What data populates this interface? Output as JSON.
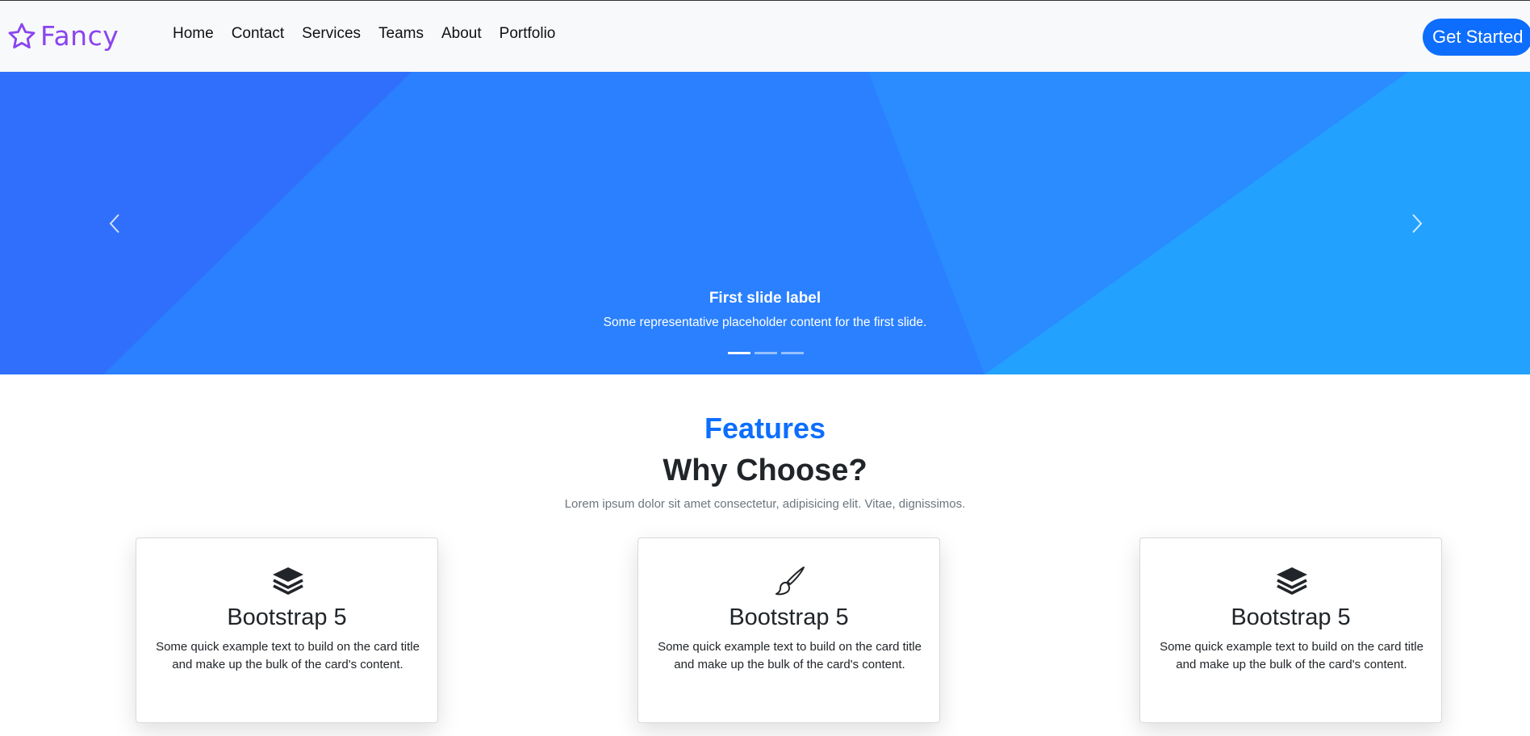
{
  "navbar": {
    "brand": "Fancy",
    "brand_icon": "star-icon",
    "brand_color": "#8a44f0",
    "links": [
      "Home",
      "Contact",
      "Services",
      "Teams",
      "About",
      "Portfolio"
    ],
    "cta_label": "Get Started",
    "cta_color": "#0d6efd"
  },
  "carousel": {
    "slide_title": "First slide label",
    "slide_text": "Some representative placeholder content for the first slide.",
    "slide_count": 3,
    "active_index": 0,
    "prev_icon": "chevron-left-icon",
    "next_icon": "chevron-right-icon",
    "colors": [
      "#2f6ffb",
      "#2a82ff",
      "#2492ff",
      "#23a1ff"
    ]
  },
  "features": {
    "kicker": "Features",
    "title": "Why Choose?",
    "subtitle": "Lorem ipsum dolor sit amet consectetur, adipisicing elit. Vitae, dignissimos.",
    "accent": "#0d6efd",
    "cards": [
      {
        "icon": "layers-icon",
        "title": "Bootstrap 5",
        "text": "Some quick example text to build on the card title and make up the bulk of the card's content."
      },
      {
        "icon": "brush-icon",
        "title": "Bootstrap 5",
        "text": "Some quick example text to build on the card title and make up the bulk of the card's content."
      },
      {
        "icon": "layers-icon",
        "title": "Bootstrap 5",
        "text": "Some quick example text to build on the card title and make up the bulk of the card's content."
      }
    ]
  }
}
